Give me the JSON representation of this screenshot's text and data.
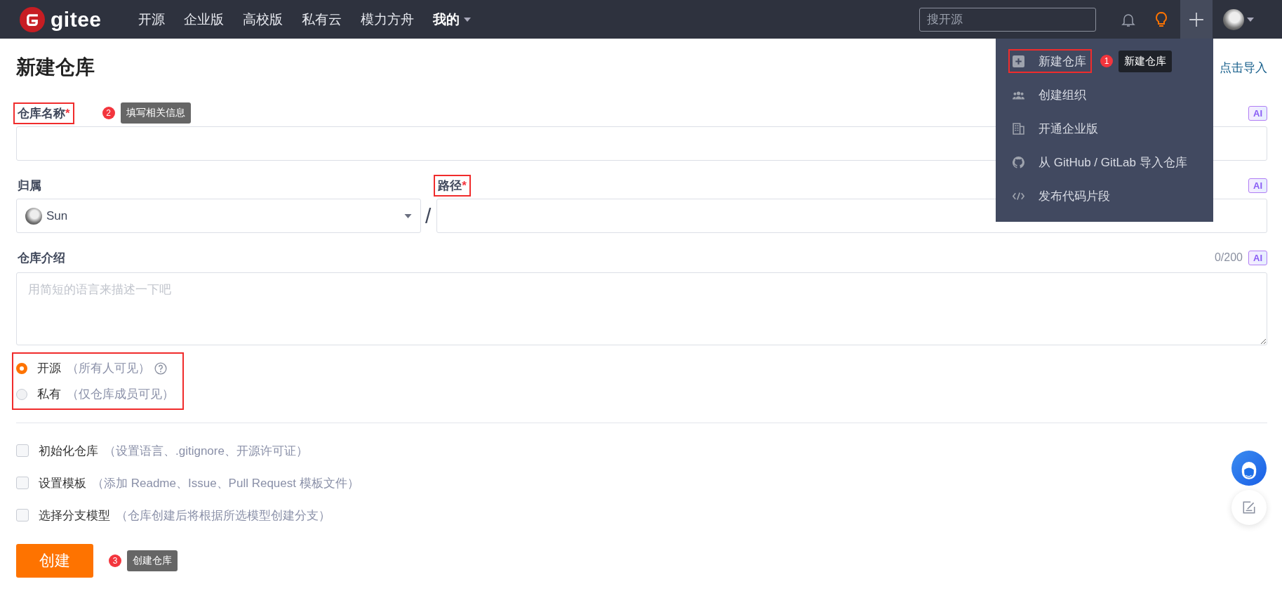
{
  "navbar": {
    "logo_text": "gitee",
    "links": [
      {
        "label": "开源",
        "dropdown": false
      },
      {
        "label": "企业版",
        "dropdown": false
      },
      {
        "label": "高校版",
        "dropdown": false
      },
      {
        "label": "私有云",
        "dropdown": false
      },
      {
        "label": "模力方舟",
        "dropdown": false
      },
      {
        "label": "我的",
        "dropdown": true
      }
    ],
    "search": {
      "placeholder": "搜开源"
    }
  },
  "new_menu": {
    "open": true,
    "items": [
      {
        "kind": "repo",
        "label": "新建仓库",
        "highlighted": true,
        "callout": {
          "number": "1",
          "text": "新建仓库"
        }
      },
      {
        "kind": "group",
        "label": "创建组织",
        "highlighted": false
      },
      {
        "kind": "enterprise",
        "label": "开通企业版",
        "highlighted": false
      },
      {
        "kind": "import",
        "label": "从 GitHub / GitLab 导入仓库",
        "highlighted": false
      },
      {
        "kind": "code",
        "label": "发布代码片段",
        "highlighted": false
      }
    ]
  },
  "page": {
    "title": "新建仓库",
    "import_link": "点击导入"
  },
  "form": {
    "name": {
      "label": "仓库名称",
      "required_mark": "*",
      "highlighted": true,
      "callout": {
        "number": "2",
        "text": "填写相关信息"
      },
      "ai_badge": "AI"
    },
    "owner": {
      "label": "归属",
      "value": "Sun"
    },
    "separator": "/",
    "path": {
      "label": "路径",
      "required_mark": "*",
      "highlighted": true,
      "ai_badge": "AI"
    },
    "description": {
      "label": "仓库介绍",
      "counter": "0/200",
      "ai_badge": "AI",
      "placeholder": "用简短的语言来描述一下吧"
    },
    "visibility": {
      "highlighted": true,
      "options": [
        {
          "label": "开源",
          "note": "（所有人可见）",
          "help": true,
          "selected": true
        },
        {
          "label": "私有",
          "note": "（仅仓库成员可见）",
          "help": false,
          "selected": false
        }
      ]
    },
    "options": [
      {
        "label": "初始化仓库",
        "note": "（设置语言、.gitignore、开源许可证）",
        "checked": false
      },
      {
        "label": "设置模板",
        "note": "（添加 Readme、Issue、Pull Request 模板文件）",
        "checked": false
      },
      {
        "label": "选择分支模型",
        "note": "（仓库创建后将根据所选模型创建分支）",
        "checked": false
      }
    ],
    "submit": {
      "label": "创建",
      "callout": {
        "number": "3",
        "text": "创建仓库"
      }
    }
  }
}
